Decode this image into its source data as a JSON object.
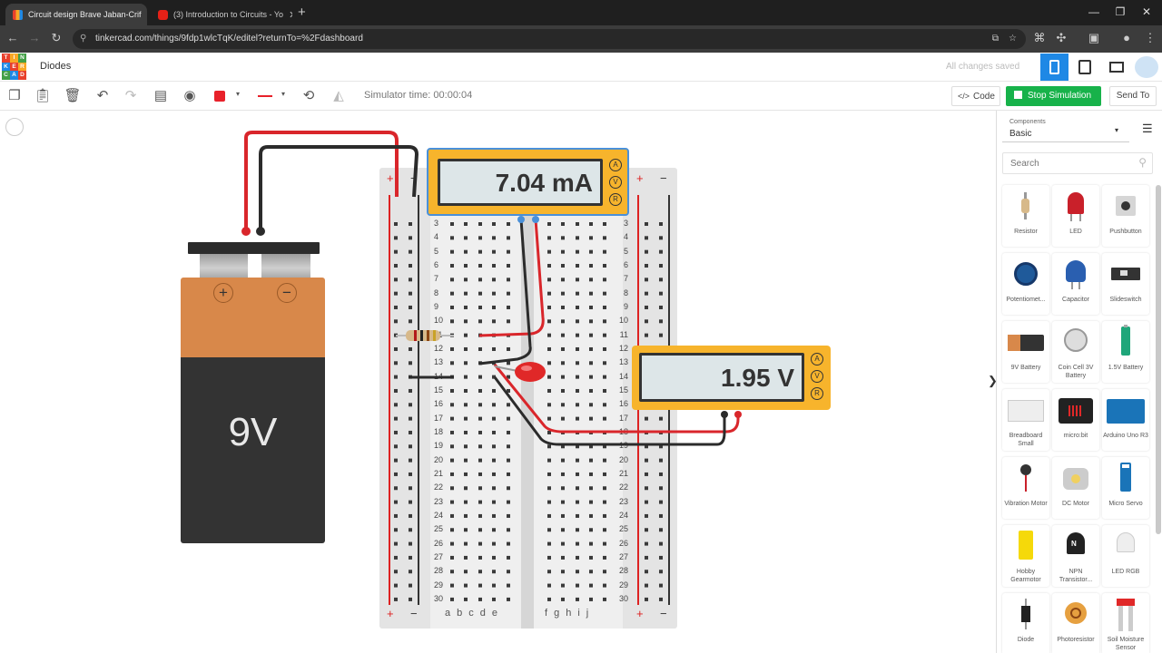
{
  "browser": {
    "tabs": [
      {
        "title": "Circuit design Brave Jaban-Crif",
        "active": true
      },
      {
        "title": "(3) Introduction to Circuits - Yo",
        "active": false
      }
    ],
    "new_tab": "+",
    "url": "tinkercad.com/things/9fdp1wlcTqK/editel?returnTo=%2Fdashboard"
  },
  "app": {
    "logo_letters": [
      "T",
      "I",
      "N",
      "K",
      "E",
      "R",
      "C",
      "A",
      "D"
    ],
    "logo_colors": [
      "#e8402c",
      "#f9a825",
      "#43a047",
      "#1e88e5",
      "#e8402c",
      "#f9a825",
      "#43a047",
      "#1e88e5",
      "#e8402c"
    ],
    "design_name": "Diodes",
    "save_status": "All changes saved"
  },
  "toolbar": {
    "simulator_time": "Simulator time: 00:00:04",
    "code_label": "Code",
    "stop_label": "Stop Simulation",
    "send_label": "Send To",
    "wire_color": "#e8212a"
  },
  "breadboard": {
    "plus": "+",
    "minus": "−",
    "columns_left": [
      "a",
      "b",
      "c",
      "d",
      "e"
    ],
    "columns_right": [
      "f",
      "g",
      "h",
      "i",
      "j"
    ],
    "rows": [
      "3",
      "4",
      "5",
      "6",
      "7",
      "8",
      "9",
      "10",
      "11",
      "12",
      "13",
      "14",
      "15",
      "16",
      "17",
      "18",
      "19",
      "20",
      "21",
      "22",
      "23",
      "24",
      "25",
      "26",
      "27",
      "28",
      "29",
      "30"
    ]
  },
  "ammeter": {
    "reading": "7.04 mA",
    "modes": [
      "A",
      "V",
      "R"
    ]
  },
  "voltmeter": {
    "reading": "1.95 V",
    "modes": [
      "A",
      "V",
      "R"
    ]
  },
  "battery": {
    "label": "9V",
    "plus": "+",
    "minus": "−"
  },
  "sidebar": {
    "components_label": "Components",
    "components_value": "Basic",
    "search_placeholder": "Search",
    "items": [
      {
        "label": "Resistor"
      },
      {
        "label": "LED"
      },
      {
        "label": "Pushbutton"
      },
      {
        "label": "Potentiomet..."
      },
      {
        "label": "Capacitor"
      },
      {
        "label": "Slideswitch"
      },
      {
        "label": "9V Battery"
      },
      {
        "label": "Coin Cell 3V Battery"
      },
      {
        "label": "1.5V Battery"
      },
      {
        "label": "Breadboard Small"
      },
      {
        "label": "micro:bit"
      },
      {
        "label": "Arduino Uno R3"
      },
      {
        "label": "Vibration Motor"
      },
      {
        "label": "DC Motor"
      },
      {
        "label": "Micro Servo"
      },
      {
        "label": "Hobby Gearmotor"
      },
      {
        "label": "NPN Transistor..."
      },
      {
        "label": "LED RGB"
      },
      {
        "label": "Diode"
      },
      {
        "label": "Photoresistor"
      },
      {
        "label": "Soil Moisture Sensor"
      }
    ]
  }
}
